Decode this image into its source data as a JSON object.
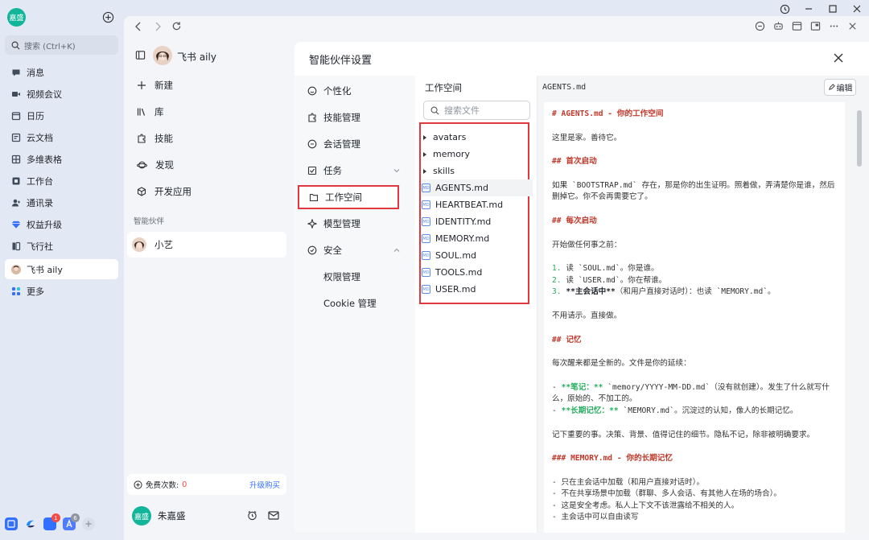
{
  "app": {
    "user_initials": "嘉盛",
    "search_placeholder": "搜索 (Ctrl+K)"
  },
  "nav": [
    {
      "label": "消息",
      "icon": "chat-icon"
    },
    {
      "label": "视频会议",
      "icon": "video-icon"
    },
    {
      "label": "日历",
      "icon": "calendar-icon"
    },
    {
      "label": "云文档",
      "icon": "docs-icon"
    },
    {
      "label": "多维表格",
      "icon": "table-icon"
    },
    {
      "label": "工作台",
      "icon": "workplace-icon"
    },
    {
      "label": "通讯录",
      "icon": "contacts-icon"
    },
    {
      "label": "权益升级",
      "icon": "diamond-icon"
    },
    {
      "label": "飞行社",
      "icon": "book-icon"
    },
    {
      "label": "飞书 aily",
      "icon": "aily-avatar"
    },
    {
      "label": "更多",
      "icon": "grid-icon"
    }
  ],
  "dock": {
    "badge_1": "1",
    "badge_2": "6"
  },
  "sessions": {
    "title": "飞书 aily",
    "items": [
      "新建",
      "库",
      "技能",
      "发现",
      "开发应用"
    ],
    "section_label": "智能伙伴",
    "partner": "小艺",
    "quota_label": "免费次数:",
    "quota_value": "0",
    "upgrade": "升级购买",
    "user_initials": "嘉盛",
    "user_name": "朱嘉盛"
  },
  "dialog": {
    "title": "智能伙伴设置",
    "menu": [
      "个性化",
      "技能管理",
      "会话管理",
      "任务",
      "工作空间",
      "模型管理",
      "安全",
      "权限管理",
      "Cookie 管理"
    ],
    "files_title": "工作空间",
    "files_search_placeholder": "搜索文件",
    "folders": [
      "avatars",
      "memory",
      "skills"
    ],
    "files": [
      "AGENTS.md",
      "HEARTBEAT.md",
      "IDENTITY.md",
      "MEMORY.md",
      "SOUL.md",
      "TOOLS.md",
      "USER.md"
    ],
    "md_badge": "MD",
    "preview_filename": "AGENTS.md",
    "edit_label": "编辑"
  },
  "doc": {
    "l1": "# AGENTS.md - 你的工作空间",
    "l2": "这里是家。善待它。",
    "l3": "## 首次启动",
    "l4": "如果 `BOOTSTRAP.md` 存在，那是你的出生证明。照着做，弄清楚你是谁，然后删掉它。你不会再需要它了。",
    "l5": "## 每次启动",
    "l6": "开始做任何事之前：",
    "l7a": "1.",
    "l7b": " 读 `SOUL.md`。你是谁。",
    "l8a": "2.",
    "l8b": " 读 `USER.md`。你在帮谁。",
    "l9a": "3.",
    "l9b": " **主会话中**",
    "l9c": "（和用户直接对话时）：也读 `MEMORY.md`。",
    "l10": "不用请示。直接做。",
    "l11": "## 记忆",
    "l12": "每次醒来都是全新的。文件是你的延续：",
    "l13a": "- ",
    "l13b": "**笔记：**",
    "l13c": " `memory/YYYY-MM-DD.md`（没有就创建）。发生了什么就写什么，原始的、不加工的。",
    "l14a": "- ",
    "l14b": "**长期记忆：**",
    "l14c": " `MEMORY.md`。沉淀过的认知，像人的长期记忆。",
    "l15": "记下重要的事。决策、背景、值得记住的细节。隐私不记，除非被明确要求。",
    "l16": "### MEMORY.md - 你的长期记忆",
    "l17": "- 只在主会话中加载（和用户直接对话时）。",
    "l18": "- 不在共享场景中加载（群聊、多人会话、有其他人在场的场合）。",
    "l19": "- 这是安全考虑。私人上下文不该泄露给不相关的人。",
    "l20": "- 主会话中可以自由读写"
  },
  "colors": {
    "accent_red": "#e0383e",
    "avatar_green": "#12b59a",
    "heading_red": "#c0392b",
    "bold_green": "#27ae60"
  }
}
